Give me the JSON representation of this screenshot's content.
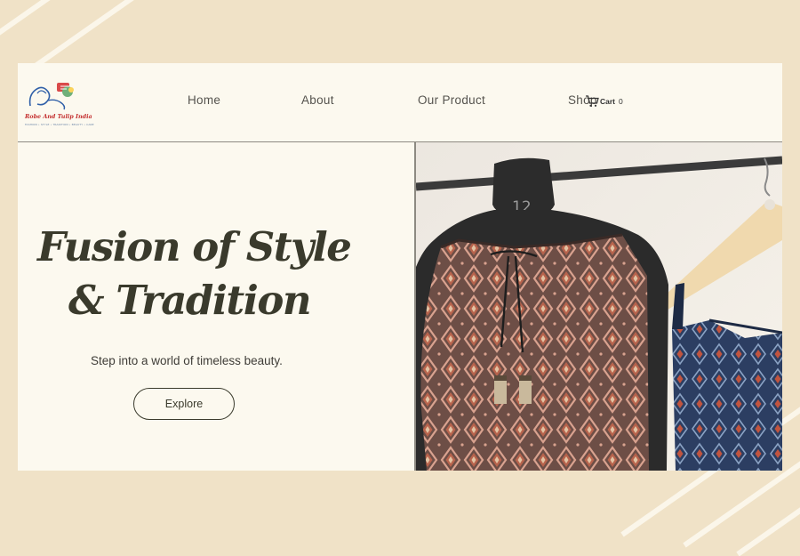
{
  "brand": {
    "logo_text": "Robe And Tulip India",
    "logo_tagline": "FASHION • STYLE • TRADITION • BEAUTY • CARE"
  },
  "nav": {
    "items": [
      {
        "label": "Home"
      },
      {
        "label": "About"
      },
      {
        "label": "Our Product"
      },
      {
        "label": "Shop"
      }
    ]
  },
  "cart": {
    "label": "Cart",
    "count": "0"
  },
  "hero": {
    "headline_line1": "Fusion of Style",
    "headline_line2": "& Tradition",
    "tagline": "Step into a world of timeless beauty.",
    "cta_label": "Explore",
    "mannequin_size": "12"
  },
  "colors": {
    "page_background": "#f0e2c7",
    "panel_background": "#fcf9ef",
    "headline": "#3a3a2c",
    "dress_print": "#6d4e46",
    "navy_garment": "#2c3e62"
  }
}
